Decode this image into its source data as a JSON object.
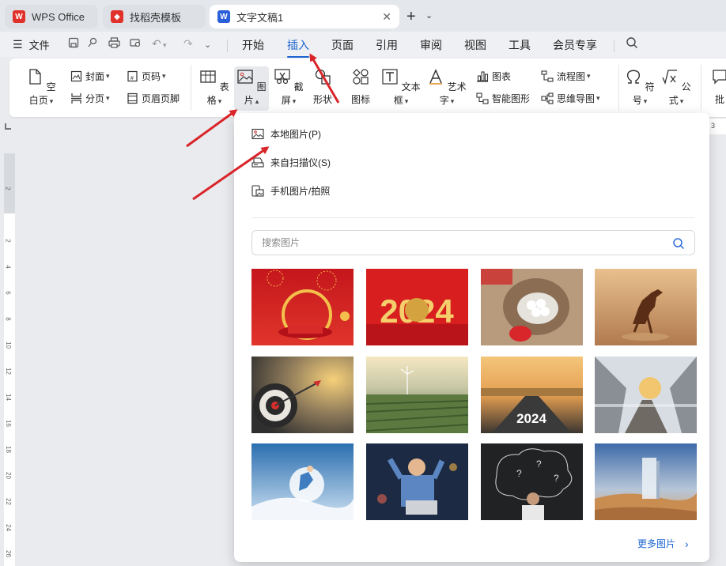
{
  "tabs": [
    {
      "label": "WPS Office",
      "color": "#e0322b"
    },
    {
      "label": "找稻壳模板",
      "color": "#e0322b"
    },
    {
      "label": "文字文稿1",
      "color": "#2b5fd9"
    }
  ],
  "menu": {
    "file": "文件",
    "items": [
      "开始",
      "插入",
      "页面",
      "引用",
      "审阅",
      "视图",
      "工具",
      "会员专享"
    ],
    "active": "插入"
  },
  "ribbon": {
    "blank_page": "空白页",
    "cover": "封面",
    "page_number": "页码",
    "page_break": "分页",
    "header_footer": "页眉页脚",
    "table": "表格",
    "picture": "图片",
    "screenshot": "截屏",
    "shape": "形状",
    "icon": "图标",
    "textbox": "文本框",
    "wordart": "艺术字",
    "chart": "图表",
    "smartart": "智能图形",
    "flowchart": "流程图",
    "mindmap": "思维导图",
    "symbol": "符号",
    "formula": "公式",
    "comment": "批"
  },
  "dropdown": {
    "local_picture": "本地图片(P)",
    "from_scanner": "来自扫描仪(S)",
    "phone_picture": "手机图片/拍照",
    "search_placeholder": "搜索图片",
    "more_pictures": "更多图片",
    "thumb_text_2024a": "2024",
    "thumb_text_2024b": "2024"
  },
  "ruler": {
    "numbers": [
      "2",
      "2",
      "4",
      "6",
      "8",
      "10",
      "12",
      "14",
      "16",
      "18",
      "20",
      "22",
      "24",
      "26"
    ],
    "top_fragment": "3"
  },
  "colors": {
    "accent": "#1c64d0",
    "annotation_arrow": "#d9252a"
  }
}
